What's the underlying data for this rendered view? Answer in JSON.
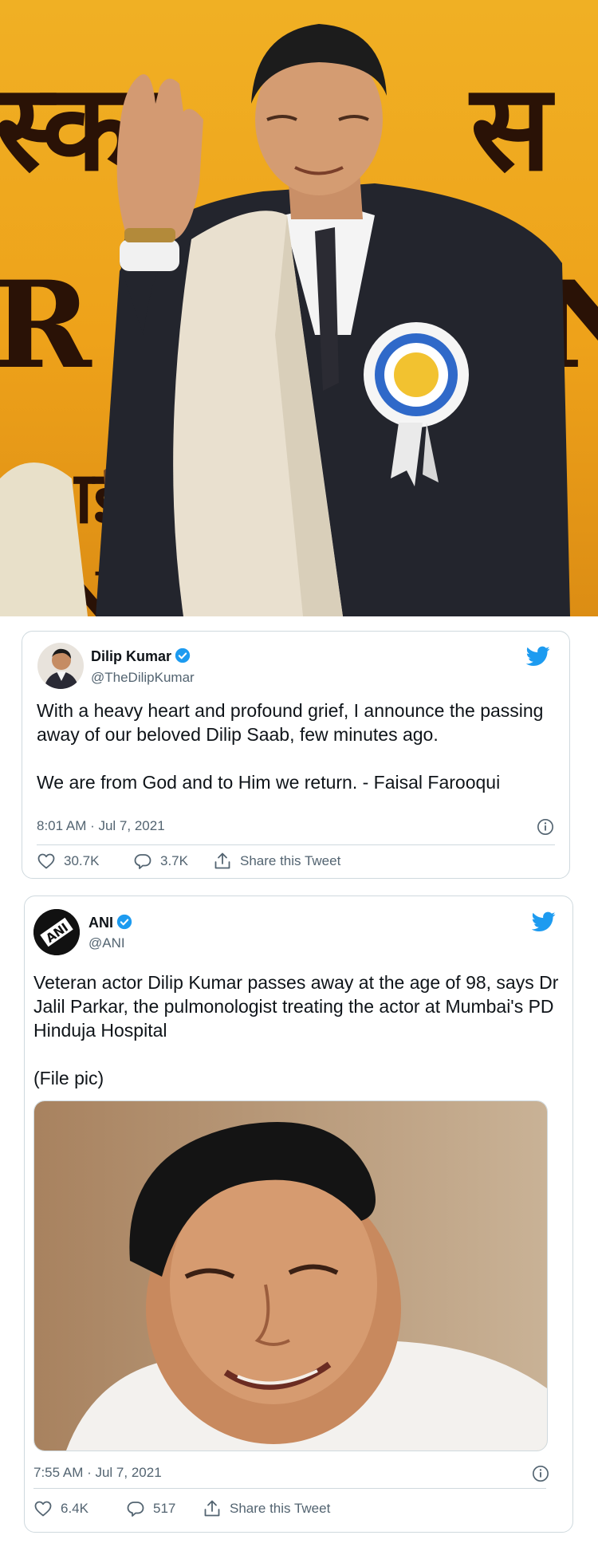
{
  "hero": {
    "bg_glyphs": [
      "स्का",
      "स",
      "R",
      "N",
      "ाई",
      "N"
    ]
  },
  "tweets": [
    {
      "name": "Dilip Kumar",
      "handle": "@TheDilipKumar",
      "text": "With a heavy heart and profound grief, I announce the passing away of our beloved Dilip Saab, few minutes ago.\n\nWe are from God and to Him we return.  - Faisal Farooqui",
      "timestamp": "8:01 AM · Jul 7, 2021",
      "likes": "30.7K",
      "replies": "3.7K",
      "share_label": "Share this Tweet"
    },
    {
      "name": "ANI",
      "handle": "@ANI",
      "text": "Veteran actor Dilip Kumar passes away at the age of 98, says Dr Jalil Parkar, the pulmonologist treating the actor at Mumbai's PD Hinduja Hospital\n\n(File pic)",
      "timestamp": "7:55 AM · Jul 7, 2021",
      "likes": "6.4K",
      "replies": "517",
      "share_label": "Share this Tweet",
      "avatar_text": "ANI"
    }
  ],
  "colors": {
    "twitter_blue": "#1d9bf0",
    "secondary_text": "#536471",
    "border": "#cfd9de",
    "hero_bg": "#eea21a"
  },
  "icons": [
    "twitter-bird-icon",
    "verified-badge-icon",
    "info-icon",
    "heart-icon",
    "reply-icon",
    "share-icon"
  ]
}
